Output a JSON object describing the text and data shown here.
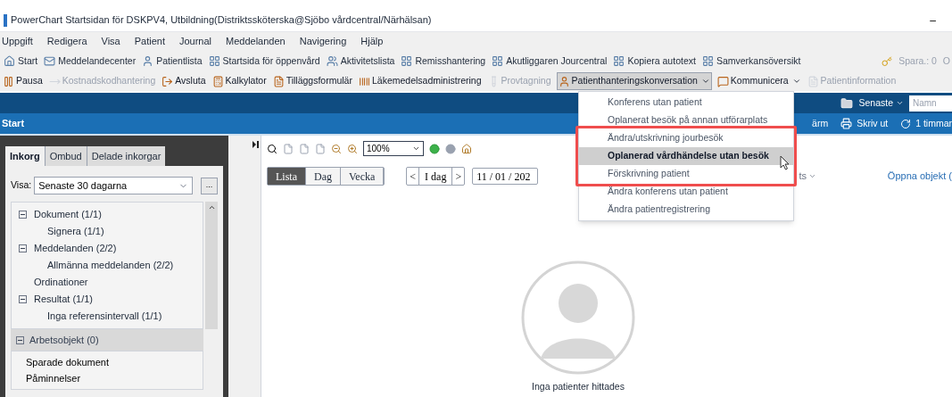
{
  "window": {
    "title": "PowerChart Startsidan för DSKPV4, Utbildning(Distriktssköterska@Sjöbo vårdcentral/Närhälsan)",
    "minimize": "–"
  },
  "menu": [
    "Uppgift",
    "Redigera",
    "Visa",
    "Patient",
    "Journal",
    "Meddelanden",
    "Navigering",
    "Hjälp"
  ],
  "toolbar_1": {
    "items": [
      {
        "label": "Start",
        "disabled": false
      },
      {
        "label": "Meddelandecenter",
        "disabled": false
      },
      {
        "label": "Patientlista",
        "disabled": false
      },
      {
        "label": "Startsida för öppenvård",
        "disabled": false
      },
      {
        "label": "Aktivitetslista",
        "disabled": false
      },
      {
        "label": "Remisshantering",
        "disabled": false
      },
      {
        "label": "Akutliggaren Jourcentral",
        "disabled": false
      },
      {
        "label": "Kopiera autotext",
        "disabled": false
      },
      {
        "label": "Samverkansöversikt",
        "disabled": false
      }
    ],
    "save": "Spara.: 0",
    "extra": "O"
  },
  "toolbar_2": {
    "items": [
      {
        "label": "Pausa",
        "disabled": false,
        "dropdown": false,
        "selected": false
      },
      {
        "label": "Kostnadskodhantering",
        "disabled": true,
        "dropdown": false,
        "selected": false
      },
      {
        "label": "Avsluta",
        "disabled": false,
        "dropdown": false,
        "selected": false
      },
      {
        "label": "Kalkylator",
        "disabled": false,
        "dropdown": false,
        "selected": false
      },
      {
        "label": "Tilläggsformulär",
        "disabled": false,
        "dropdown": false,
        "selected": false
      },
      {
        "label": "Läkemedelsadministrering",
        "disabled": false,
        "dropdown": false,
        "selected": false
      },
      {
        "label": "Provtagning",
        "disabled": true,
        "dropdown": false,
        "selected": false
      },
      {
        "label": "Patienthanteringskonversation",
        "disabled": false,
        "dropdown": true,
        "selected": true
      },
      {
        "label": "Kommunicera",
        "disabled": false,
        "dropdown": true,
        "selected": false
      },
      {
        "label": "Patientinformation",
        "disabled": true,
        "dropdown": false,
        "selected": false
      }
    ]
  },
  "header_bar": {
    "recent": "Senaste",
    "search": {
      "placeholder": "Namn"
    }
  },
  "page_bar": {
    "title": "Start",
    "actions": [
      "ärm",
      "Skriv ut",
      "1 timmar"
    ]
  },
  "inbox": {
    "tabs": [
      {
        "label": "Inkorg",
        "selected": true
      },
      {
        "label": "Ombud",
        "selected": false
      },
      {
        "label": "Delade inkorgar",
        "selected": false
      }
    ],
    "filter_label": "Visa:",
    "filter_value": "Senaste 30 dagarna",
    "more": "...",
    "tree": [
      {
        "label": "Dokument (1/1)",
        "expanded": true,
        "children": [
          {
            "label": "Signera (1/1)"
          }
        ]
      },
      {
        "label": "Meddelanden (2/2)",
        "expanded": true,
        "children": [
          {
            "label": "Allmänna meddelanden (2/2)"
          }
        ]
      },
      {
        "label": "Ordinationer"
      },
      {
        "label": "Resultat (1/1)",
        "expanded": true,
        "children": [
          {
            "label": "Inga referensintervall (1/1)"
          }
        ]
      }
    ],
    "work_section": {
      "label": "Arbetsobjekt (0)",
      "expanded": true,
      "items": [
        "Sparade dokument",
        "Påminnelser"
      ]
    }
  },
  "calendar": {
    "zoom": "100%",
    "views": [
      {
        "label": "Lista",
        "selected": true
      },
      {
        "label": "Dag",
        "selected": false
      },
      {
        "label": "Vecka",
        "selected": false
      }
    ],
    "prev": "<",
    "today": "I dag",
    "next": ">",
    "date": "11 / 01 / 202",
    "filter": "ts",
    "open_items": "Öppna objekt (",
    "empty": "Inga patienter hittades"
  },
  "dropdown_menu": {
    "items": [
      {
        "label": "Konferens utan patient",
        "selected": false
      },
      {
        "label": "Oplanerat besök på annan utförarplats",
        "selected": false
      },
      {
        "label": "Ändra/utskrivning jourbesök",
        "selected": false
      },
      {
        "label": "Oplanerad vårdhändelse utan besök",
        "selected": true
      },
      {
        "label": "Förskrivning patient",
        "selected": false
      },
      {
        "label": "Ändra konferens utan patient",
        "selected": false
      },
      {
        "label": "Ändra patientregistrering",
        "selected": false
      }
    ]
  }
}
